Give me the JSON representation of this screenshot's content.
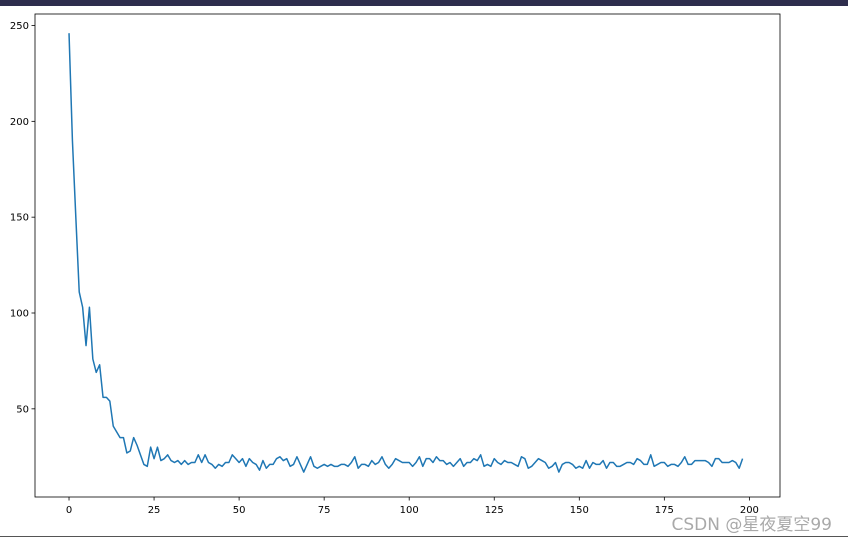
{
  "watermark": "CSDN @星夜夏空99",
  "chart_data": {
    "type": "line",
    "title": "",
    "xlabel": "",
    "ylabel": "",
    "xlim": [
      -10,
      209
    ],
    "ylim": [
      4,
      256
    ],
    "x_ticks": [
      0,
      25,
      50,
      75,
      100,
      125,
      150,
      175,
      200
    ],
    "y_ticks": [
      50,
      100,
      150,
      200,
      250
    ],
    "grid": false,
    "series": [
      {
        "color": "#1f77b4",
        "x_start": 0,
        "x_step": 1,
        "values": [
          246,
          190,
          150,
          111,
          103,
          83,
          103,
          76,
          69,
          73,
          56,
          56,
          54,
          41,
          38,
          35,
          35,
          27,
          28,
          35,
          31,
          26,
          21,
          20,
          30,
          24,
          30,
          23,
          24,
          26,
          23,
          22,
          23,
          21,
          23,
          21,
          22,
          22,
          26,
          22,
          26,
          22,
          21,
          19,
          21,
          20,
          22,
          22,
          26,
          24,
          22,
          24,
          20,
          24,
          22,
          21,
          18,
          23,
          19,
          21,
          21,
          24,
          25,
          23,
          24,
          20,
          21,
          25,
          21,
          17,
          21,
          25,
          20,
          19,
          20,
          21,
          20,
          21,
          20,
          20,
          21,
          21,
          20,
          22,
          25,
          19,
          21,
          21,
          20,
          23,
          21,
          22,
          25,
          21,
          19,
          21,
          24,
          23,
          22,
          22,
          22,
          20,
          22,
          25,
          20,
          24,
          24,
          22,
          25,
          23,
          23,
          21,
          22,
          20,
          22,
          24,
          20,
          22,
          22,
          24,
          23,
          26,
          20,
          21,
          20,
          24,
          22,
          21,
          23,
          22,
          22,
          21,
          20,
          25,
          24,
          19,
          20,
          22,
          24,
          23,
          22,
          19,
          20,
          22,
          17,
          21,
          22,
          22,
          21,
          19,
          20,
          19,
          23,
          19,
          22,
          21,
          21,
          23,
          19,
          22,
          22,
          20,
          20,
          21,
          22,
          22,
          21,
          24,
          23,
          21,
          21,
          26,
          20,
          21,
          22,
          22,
          20,
          21,
          21,
          20,
          22,
          25,
          21,
          21,
          23,
          23,
          23,
          23,
          22,
          20,
          24,
          24,
          22,
          22,
          22,
          23,
          22,
          19,
          24
        ]
      }
    ]
  }
}
